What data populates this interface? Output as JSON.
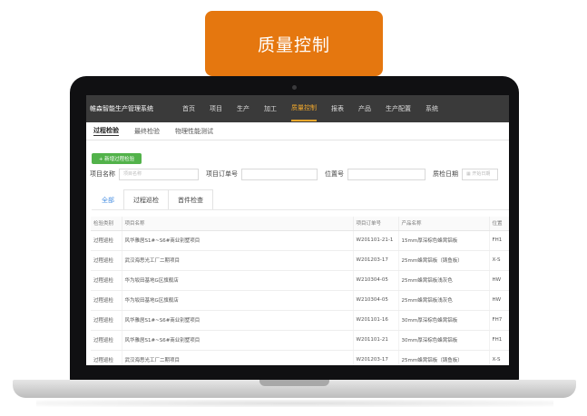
{
  "banner": {
    "title": "质量控制"
  },
  "app": {
    "brand": "帷森智能生产管理系统",
    "nav": [
      "首页",
      "项目",
      "生产",
      "加工",
      "质量控制",
      "报表",
      "产品",
      "生产配置",
      "系统"
    ],
    "subnav": [
      "过程检验",
      "最终检验",
      "物理性能测试"
    ],
    "add_button": "+ 新增过程检验",
    "filters": {
      "project_name_label": "项目名称",
      "project_name_placeholder": "项目名称",
      "order_no_label": "项目订单号",
      "position_label": "位置号",
      "date_label": "质检日期",
      "date_placeholder": "开始日期"
    },
    "tabs": [
      "全部",
      "过程巡检",
      "首件检查"
    ],
    "table": {
      "headers": [
        "检验类别",
        "项目名称",
        "项目订单号",
        "产品名称",
        "位置"
      ],
      "rows": [
        [
          "过程巡检",
          "风华雅居S1#~S6#商业别墅项目",
          "W201101-21-1",
          "15mm厚深棕色蜂窝铝板",
          "FH1"
        ],
        [
          "过程巡检",
          "武汉海思光工厂二期项目",
          "W201203-17",
          "25mm蜂窝铝板（铸鱼板）",
          "X-S"
        ],
        [
          "过程巡检",
          "华为坂田基地G区旗舰店",
          "W210304-05",
          "25mm蜂窝铝板浅灰色",
          "HW"
        ],
        [
          "过程巡检",
          "华为坂田基地G区旗舰店",
          "W210304-05",
          "25mm蜂窝铝板浅灰色",
          "HW"
        ],
        [
          "过程巡检",
          "风华雅居S1#~S6#商业别墅项目",
          "W201101-16",
          "30mm厚深棕色蜂窝铝板",
          "FH7"
        ],
        [
          "过程巡检",
          "风华雅居S1#~S6#商业别墅项目",
          "W201101-21",
          "30mm厚深棕色蜂窝铝板",
          "FH1"
        ],
        [
          "过程巡检",
          "武汉海思光工厂二期项目",
          "W201203-17",
          "25mm蜂窝铝板（铸鱼板）",
          "X-S"
        ]
      ]
    }
  }
}
